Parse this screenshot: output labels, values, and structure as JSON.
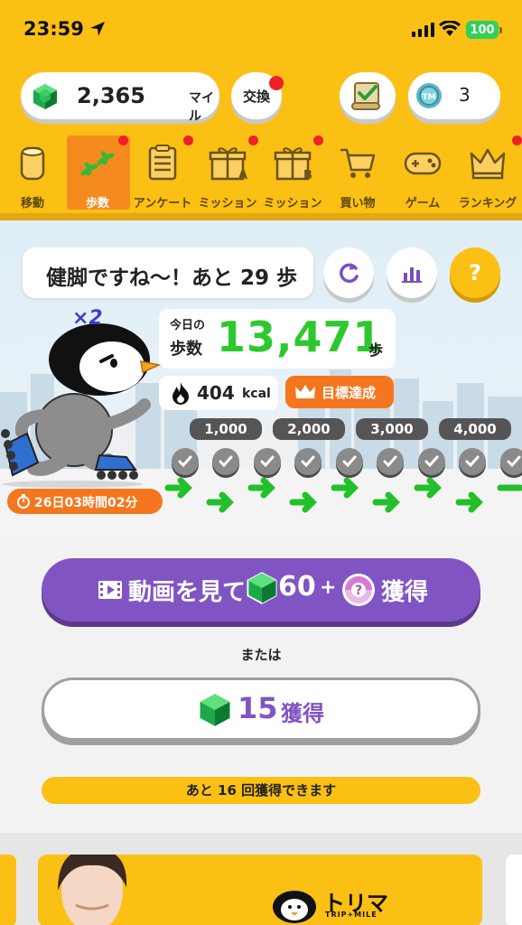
{
  "status": {
    "time": "23:59",
    "battery": "100"
  },
  "header": {
    "miles_value": "2,365",
    "miles_unit": "マイル",
    "exchange_label": "交換",
    "coin_count": "3"
  },
  "nav": {
    "items": [
      {
        "label": "移動",
        "icon": "can-icon"
      },
      {
        "label": "歩数",
        "icon": "footprints-icon"
      },
      {
        "label": "アンケート",
        "icon": "clipboard-icon"
      },
      {
        "label": "ミッション",
        "icon": "gift-a-icon"
      },
      {
        "label": "ミッション",
        "icon": "gift-b-icon"
      },
      {
        "label": "買い物",
        "icon": "cart-icon"
      },
      {
        "label": "ゲーム",
        "icon": "gamepad-icon"
      },
      {
        "label": "ランキング",
        "icon": "crown-icon"
      }
    ]
  },
  "steps": {
    "speech": "健脚ですね〜！あと 29 歩",
    "multiplier": "×2",
    "today_label": "今日の",
    "steps_label": "歩数",
    "count": "13,471",
    "unit": "歩",
    "kcal_value": "404",
    "kcal_unit": "kcal",
    "goal_label": "目標達成",
    "milestones": [
      "1,000",
      "2,000",
      "3,000",
      "4,000"
    ],
    "countdown": "26日03時間02分",
    "help": "?"
  },
  "actions": {
    "video_label": "動画を見て",
    "video_amount": "60",
    "video_plus": "+",
    "video_get": "獲得",
    "or_label": "または",
    "gem_amount": "15",
    "gem_get": "獲得",
    "remaining": "あと 16 回獲得できます"
  },
  "banner": {
    "title": "トリマ",
    "subtitle": "TRIP+MILE"
  },
  "colors": {
    "yellow": "#fbc014",
    "orange": "#f5761e",
    "purple": "#8154c3",
    "green": "#2ec82e"
  }
}
